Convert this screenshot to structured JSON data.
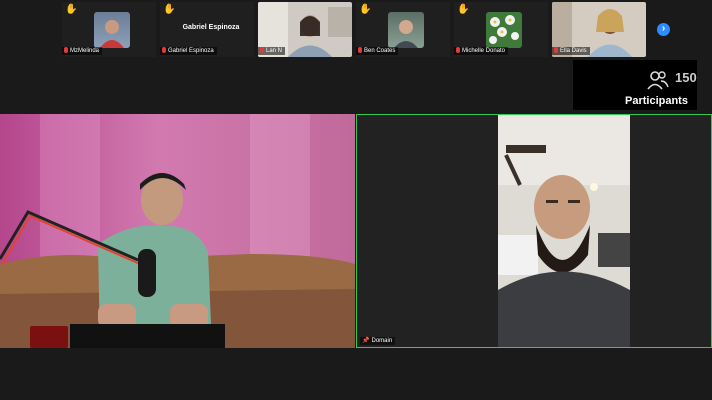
{
  "participant_strip": [
    {
      "label": "MzMelinda",
      "raised_hand": true,
      "type": "thumb",
      "bg": "#7a8aa0"
    },
    {
      "label": "Gabriel Espinoza",
      "display_name": "Gabriel Espinoza",
      "raised_hand": true,
      "type": "name"
    },
    {
      "label": "Lan N",
      "raised_hand": false,
      "type": "video",
      "bg": "#c9c4bd"
    },
    {
      "label": "Ben Coates",
      "raised_hand": true,
      "type": "thumb",
      "bg": "#6b7e73"
    },
    {
      "label": "Michelle Donato",
      "raised_hand": true,
      "type": "thumb",
      "bg": "#4f8a4a"
    },
    {
      "label": "Ella Davis",
      "raised_hand": false,
      "type": "video",
      "bg": "#c9c0b3"
    }
  ],
  "hand_icon": "✋",
  "next_page_icon": "chevron-right-icon",
  "participants_panel": {
    "count": "150",
    "label": "Participants"
  },
  "main_videos": {
    "right_label": "Domain"
  },
  "colors": {
    "active_speaker": "#34c759",
    "accent": "#2d8cff",
    "muted": "#e03a3a"
  }
}
